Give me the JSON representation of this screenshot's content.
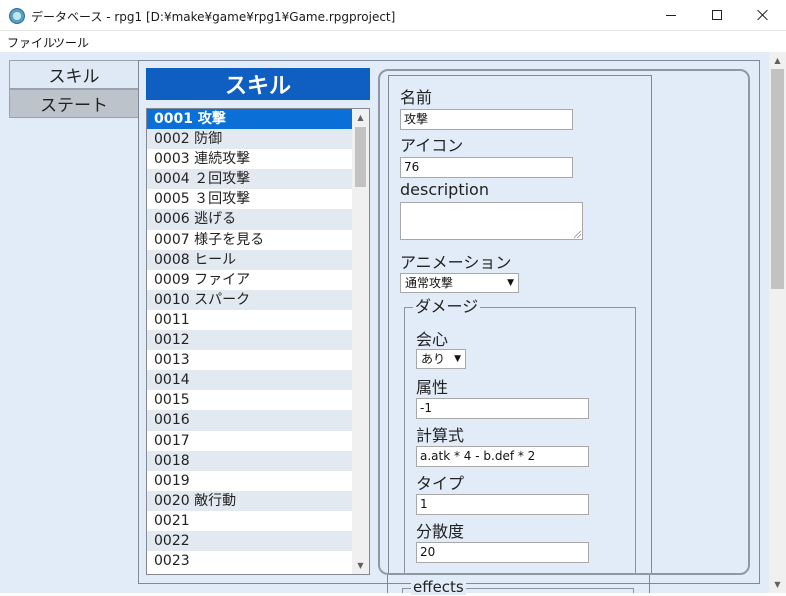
{
  "window": {
    "title": "データベース - rpg1 [D:¥make¥game¥rpg1¥Game.rpgproject]"
  },
  "menu": {
    "file": "ファイル",
    "tools": "ツール"
  },
  "tabs": {
    "skill": "スキル",
    "state": "ステート"
  },
  "list": {
    "header": "スキル",
    "selected_index": 0,
    "items": [
      "0001 攻撃",
      "0002 防御",
      "0003 連続攻撃",
      "0004 ２回攻撃",
      "0005 ３回攻撃",
      "0006 逃げる",
      "0007 様子を見る",
      "0008 ヒール",
      "0009 ファイア",
      "0010 スパーク",
      "0011",
      "0012",
      "0013",
      "0014",
      "0015",
      "0016",
      "0017",
      "0018",
      "0019",
      "0020 敵行動",
      "0021",
      "0022",
      "0023"
    ]
  },
  "form": {
    "name_label": "名前",
    "name_value": "攻撃",
    "icon_label": "アイコン",
    "icon_value": "76",
    "description_label": "description",
    "description_value": "",
    "animation_label": "アニメーション",
    "animation_value": "通常攻撃",
    "damage": {
      "legend": "ダメージ",
      "critical_label": "会心",
      "critical_value": "あり",
      "element_label": "属性",
      "element_value": "-1",
      "formula_label": "計算式",
      "formula_value": "a.atk * 4 - b.def * 2",
      "type_label": "タイプ",
      "type_value": "1",
      "variance_label": "分散度",
      "variance_value": "20"
    },
    "effects_legend": "effects"
  }
}
